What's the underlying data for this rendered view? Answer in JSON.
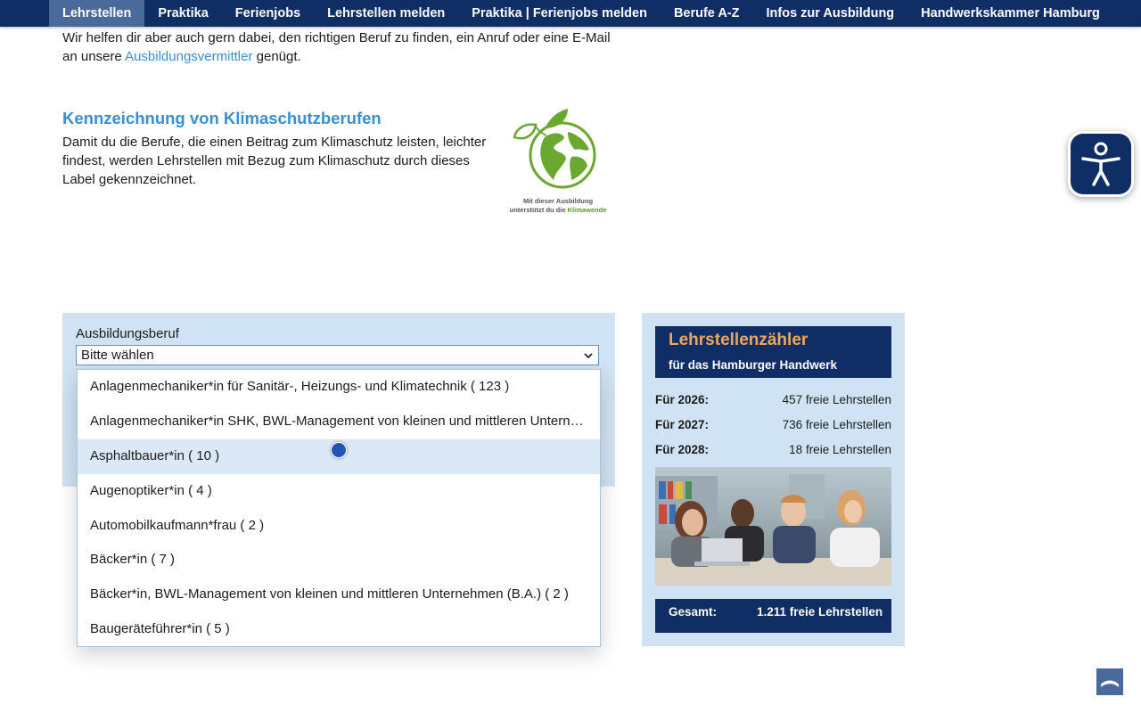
{
  "nav": {
    "items": [
      {
        "label": "Lehrstellen",
        "active": true
      },
      {
        "label": "Praktika"
      },
      {
        "label": "Ferienjobs"
      },
      {
        "label": "Lehrstellen melden"
      },
      {
        "label": "Praktika | Ferienjobs melden"
      },
      {
        "label": "Berufe A-Z"
      },
      {
        "label": "Infos zur Ausbildung"
      },
      {
        "label": "Handwerkskammer Hamburg"
      }
    ]
  },
  "intro": {
    "text_before": "Wir helfen dir aber auch gern dabei, den richtigen Beruf zu finden, ein Anruf oder eine E-Mail an unsere ",
    "link": "Ausbildungsvermittler",
    "text_after": " genügt."
  },
  "klima": {
    "title": "Kennzeichnung von Klimaschutzberufen",
    "text": "Damit du die Berufe, die einen Beitrag zum Klimaschutz leisten, leichter findest, werden Lehrstellen mit Bezug zum Klimaschutz durch dieses Label gekennzeichnet.",
    "logo_line1": "Mit dieser Ausbildung",
    "logo_line2": "unterstützt du die ",
    "logo_highlight": "Klimawende"
  },
  "search": {
    "label": "Ausbildungsberuf",
    "selected": "Bitte wählen",
    "options": [
      "Anlagenmechaniker*in für Sanitär-, Heizungs- und Klimatechnik ( 123 )",
      "Anlagenmechaniker*in SHK, BWL-Management von kleinen und mittleren Unternehmen (B.A.)",
      "Asphaltbauer*in ( 10 )",
      "Augenoptiker*in ( 4 )",
      "Automobilkaufmann*frau ( 2 )",
      "Bäcker*in ( 7 )",
      "Bäcker*in, BWL-Management von kleinen und mittleren Unternehmen (B.A.) ( 2 )",
      "Baugeräteführer*in ( 5 )"
    ],
    "hover_index": 2
  },
  "counter": {
    "title": "Lehrstellenzähler",
    "subtitle": "für das Hamburger Handwerk",
    "rows": [
      {
        "year": "Für 2026:",
        "value": "457 freie Lehrstellen"
      },
      {
        "year": "Für 2027:",
        "value": "736 freie Lehrstellen"
      },
      {
        "year": "Für 2028:",
        "value": "18 freie Lehrstellen"
      }
    ],
    "total_label": "Gesamt:",
    "total_value": "1.211 freie Lehrstellen"
  },
  "colors": {
    "nav_bg": "#0f2e66",
    "nav_active": "#4a6a9c",
    "link": "#3a8fd1",
    "panel_bg": "#cfe3f4",
    "counter_accent": "#f2a65a",
    "klima_green": "#5a9e2a"
  },
  "icons": {
    "accessibility": "accessibility-person-icon",
    "scroll_top": "chevron-up-icon",
    "select": "chevron-down-icon"
  }
}
